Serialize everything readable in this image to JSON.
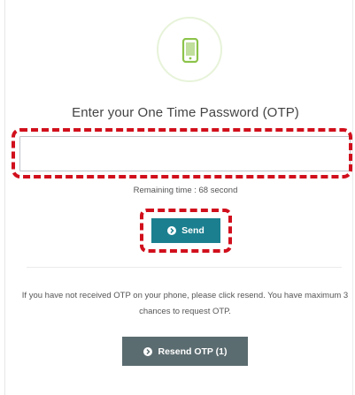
{
  "otp": {
    "icon": "mobile-phone-icon",
    "title": "Enter your One Time Password (OTP)",
    "input_value": "",
    "remaining_time": "Remaining time : 68 second",
    "send_label": "Send",
    "info_text": "If you have not received OTP on your phone, please click resend. You have maximum 3 chances to request OTP.",
    "resend_label": "Resend OTP (1)"
  },
  "colors": {
    "send_button": "#1b7f8f",
    "resend_button": "#5b6c70",
    "highlight": "#d10f1c",
    "phone_icon": "#8cc34a"
  }
}
